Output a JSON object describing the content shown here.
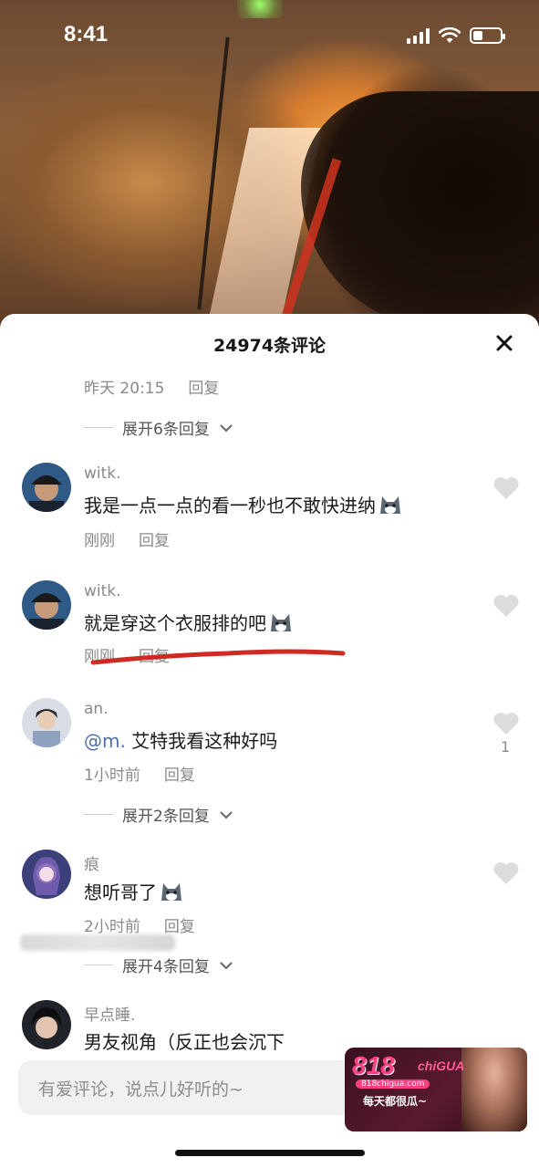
{
  "status_bar": {
    "time": "8:41"
  },
  "sheet": {
    "title": "24974条评论"
  },
  "top_meta": {
    "time": "昨天 20:15",
    "reply": "回复"
  },
  "expand_1": {
    "label": "展开6条回复"
  },
  "comments": [
    {
      "user": "witk.",
      "text": "我是一点一点的看一秒也不敢快进纳",
      "time": "刚刚",
      "reply": "回复"
    },
    {
      "user": "witk.",
      "text": "就是穿这个衣服排的吧",
      "time": "刚刚",
      "reply": "回复"
    },
    {
      "user": "an.",
      "mention": "@m.",
      "text": " 艾特我看这种好吗",
      "time": "1小时前",
      "reply": "回复",
      "likes": "1"
    },
    {
      "user": "痕",
      "text": "想听哥了",
      "time": "2小时前",
      "reply": "回复"
    },
    {
      "user": "早点睡.",
      "text": "男友视角（反正也会沉下"
    }
  ],
  "expand_2": {
    "label": "展开2条回复"
  },
  "expand_3": {
    "label": "展开4条回复"
  },
  "input": {
    "placeholder": "有爱评论，说点儿好听的~"
  },
  "watermark": {
    "brand": "818",
    "brand_suffix": "chiGUA",
    "site": "818chigua.com",
    "slogan": "每天都很瓜~"
  }
}
